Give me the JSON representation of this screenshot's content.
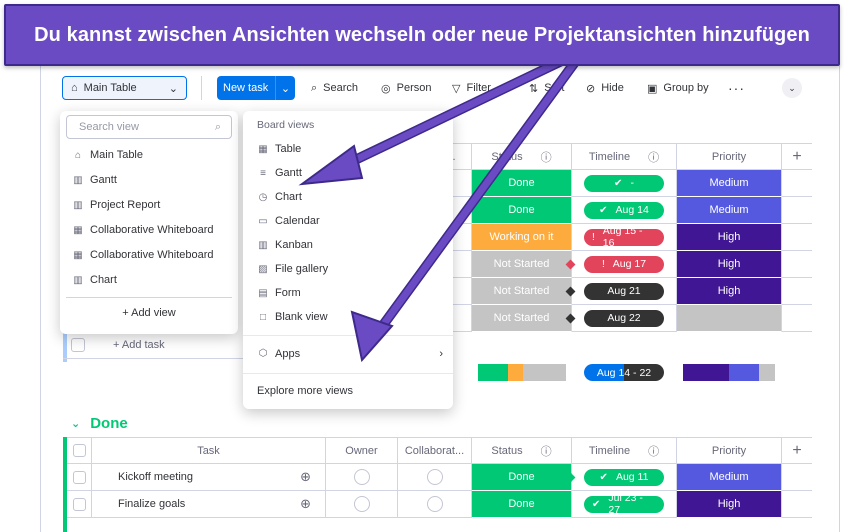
{
  "banner": {
    "text": "Du kannst zwischen Ansichten wechseln oder neue Projektansichten hinzufügen"
  },
  "toolbar": {
    "view_switch": "Main Table",
    "new_task": "New task",
    "search": "Search",
    "person": "Person",
    "filter": "Filter",
    "sort": "Sort",
    "hide": "Hide",
    "group_by": "Group by"
  },
  "views_menu": {
    "search_placeholder": "Search view",
    "items": [
      "Main Table",
      "Gantt",
      "Project Report",
      "Collaborative Whiteboard",
      "Collaborative Whiteboard",
      "Chart"
    ],
    "add_view": "+ Add view"
  },
  "board_menu": {
    "heading": "Board views",
    "items": [
      "Table",
      "Gantt",
      "Chart",
      "Calendar",
      "Kanban",
      "File gallery",
      "Form",
      "Blank view"
    ],
    "apps": "Apps",
    "explore": "Explore more views"
  },
  "group1": {
    "headers": {
      "status": "Status",
      "timeline": "Timeline",
      "priority": "Priority",
      "ellipsis": "..."
    },
    "rows": [
      {
        "status": "Done",
        "timeline": "-",
        "priority": "Medium"
      },
      {
        "status": "Done",
        "timeline": "Aug 14",
        "priority": "Medium"
      },
      {
        "status": "Working on it",
        "timeline": "Aug 15 - 16",
        "priority": "High"
      },
      {
        "status": "Not Started",
        "timeline": "Aug 17",
        "priority": "High"
      },
      {
        "status": "Not Started",
        "timeline": "Aug 21",
        "priority": "High"
      },
      {
        "status": "Not Started",
        "timeline": "Aug 22",
        "priority": ""
      }
    ],
    "add_task": "+ Add task",
    "summary_timeline": "Aug 14 - 22"
  },
  "group2": {
    "title": "Done",
    "headers": {
      "task": "Task",
      "owner": "Owner",
      "collaborator": "Collaborat...",
      "status": "Status",
      "timeline": "Timeline",
      "priority": "Priority"
    },
    "rows": [
      {
        "task": "Kickoff meeting",
        "status": "Done",
        "timeline": "Aug 11",
        "priority": "Medium"
      },
      {
        "task": "Finalize goals",
        "status": "Done",
        "timeline": "Jul 23 - 27",
        "priority": "High"
      }
    ]
  },
  "colors": {
    "done": "#00c875",
    "working": "#fdab3d",
    "not_started": "#c4c4c4",
    "medium": "#5559df",
    "high": "#401694",
    "accent": "#0073ea",
    "banner": "#6a4bc4"
  }
}
